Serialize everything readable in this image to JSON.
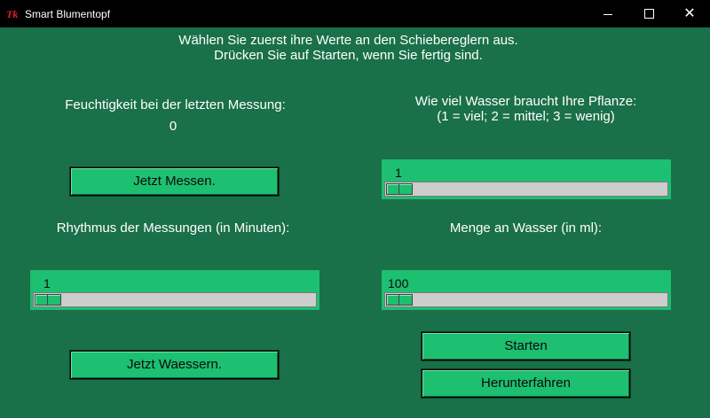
{
  "window": {
    "title": "Smart Blumentopf",
    "logo_text": "Tk"
  },
  "intro": {
    "line1": "Wählen Sie zuerst ihre Werte an den Schiebereglern aus.",
    "line2": "Drücken Sie auf Starten, wenn Sie fertig sind."
  },
  "moisture": {
    "label": "Feuchtigkeit bei der letzten Messung:",
    "value": "0"
  },
  "measure_button": {
    "label": "Jetzt Messen."
  },
  "rhythm": {
    "label": "Rhythmus der Messungen (in Minuten):",
    "value": "1"
  },
  "water_button": {
    "label": "Jetzt Waessern."
  },
  "water_need": {
    "line1": "Wie viel Wasser braucht Ihre Pflanze:",
    "line2": "(1 = viel; 2 = mittel; 3 = wenig)",
    "value": "1"
  },
  "water_amount": {
    "label": "Menge an Wasser (in ml):",
    "value": "100"
  },
  "start_button": {
    "label": "Starten"
  },
  "shutdown_button": {
    "label": "Herunterfahren"
  },
  "colors": {
    "background": "#1a7049",
    "accent": "#1dbf71",
    "trough": "#cdcdcd"
  },
  "icons": {
    "minimize": "minimize-icon",
    "maximize": "maximize-icon",
    "close": "close-icon"
  }
}
